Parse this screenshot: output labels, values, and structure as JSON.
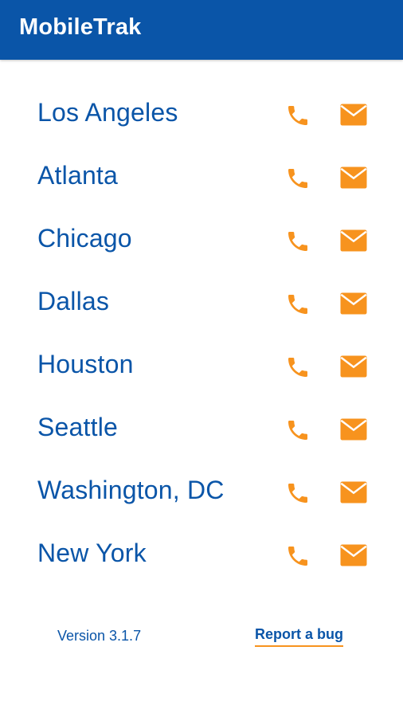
{
  "app": {
    "title": "MobileTrak"
  },
  "colors": {
    "brand": "#0a55a8",
    "accent": "#f7931e"
  },
  "icons": {
    "phone": "phone-icon",
    "mail": "mail-icon"
  },
  "locations": [
    {
      "name": "Los Angeles"
    },
    {
      "name": "Atlanta"
    },
    {
      "name": "Chicago"
    },
    {
      "name": "Dallas"
    },
    {
      "name": "Houston"
    },
    {
      "name": "Seattle"
    },
    {
      "name": "Washington, DC"
    },
    {
      "name": "New York"
    }
  ],
  "footer": {
    "version": "Version 3.1.7",
    "report_bug": "Report a bug"
  }
}
